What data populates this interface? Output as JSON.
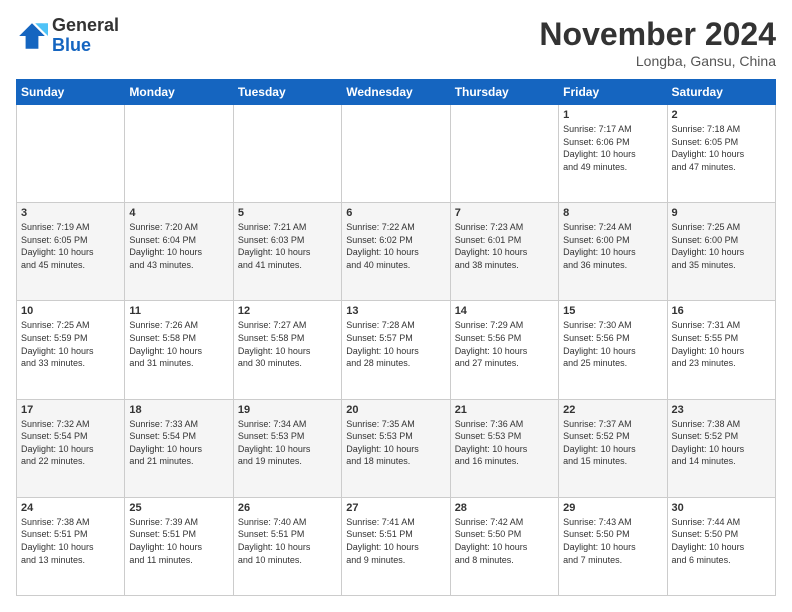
{
  "header": {
    "logo_general": "General",
    "logo_blue": "Blue",
    "month_title": "November 2024",
    "location": "Longba, Gansu, China"
  },
  "calendar": {
    "days_of_week": [
      "Sunday",
      "Monday",
      "Tuesday",
      "Wednesday",
      "Thursday",
      "Friday",
      "Saturday"
    ],
    "weeks": [
      [
        {
          "day": "",
          "info": ""
        },
        {
          "day": "",
          "info": ""
        },
        {
          "day": "",
          "info": ""
        },
        {
          "day": "",
          "info": ""
        },
        {
          "day": "",
          "info": ""
        },
        {
          "day": "1",
          "info": "Sunrise: 7:17 AM\nSunset: 6:06 PM\nDaylight: 10 hours\nand 49 minutes."
        },
        {
          "day": "2",
          "info": "Sunrise: 7:18 AM\nSunset: 6:05 PM\nDaylight: 10 hours\nand 47 minutes."
        }
      ],
      [
        {
          "day": "3",
          "info": "Sunrise: 7:19 AM\nSunset: 6:05 PM\nDaylight: 10 hours\nand 45 minutes."
        },
        {
          "day": "4",
          "info": "Sunrise: 7:20 AM\nSunset: 6:04 PM\nDaylight: 10 hours\nand 43 minutes."
        },
        {
          "day": "5",
          "info": "Sunrise: 7:21 AM\nSunset: 6:03 PM\nDaylight: 10 hours\nand 41 minutes."
        },
        {
          "day": "6",
          "info": "Sunrise: 7:22 AM\nSunset: 6:02 PM\nDaylight: 10 hours\nand 40 minutes."
        },
        {
          "day": "7",
          "info": "Sunrise: 7:23 AM\nSunset: 6:01 PM\nDaylight: 10 hours\nand 38 minutes."
        },
        {
          "day": "8",
          "info": "Sunrise: 7:24 AM\nSunset: 6:00 PM\nDaylight: 10 hours\nand 36 minutes."
        },
        {
          "day": "9",
          "info": "Sunrise: 7:25 AM\nSunset: 6:00 PM\nDaylight: 10 hours\nand 35 minutes."
        }
      ],
      [
        {
          "day": "10",
          "info": "Sunrise: 7:25 AM\nSunset: 5:59 PM\nDaylight: 10 hours\nand 33 minutes."
        },
        {
          "day": "11",
          "info": "Sunrise: 7:26 AM\nSunset: 5:58 PM\nDaylight: 10 hours\nand 31 minutes."
        },
        {
          "day": "12",
          "info": "Sunrise: 7:27 AM\nSunset: 5:58 PM\nDaylight: 10 hours\nand 30 minutes."
        },
        {
          "day": "13",
          "info": "Sunrise: 7:28 AM\nSunset: 5:57 PM\nDaylight: 10 hours\nand 28 minutes."
        },
        {
          "day": "14",
          "info": "Sunrise: 7:29 AM\nSunset: 5:56 PM\nDaylight: 10 hours\nand 27 minutes."
        },
        {
          "day": "15",
          "info": "Sunrise: 7:30 AM\nSunset: 5:56 PM\nDaylight: 10 hours\nand 25 minutes."
        },
        {
          "day": "16",
          "info": "Sunrise: 7:31 AM\nSunset: 5:55 PM\nDaylight: 10 hours\nand 23 minutes."
        }
      ],
      [
        {
          "day": "17",
          "info": "Sunrise: 7:32 AM\nSunset: 5:54 PM\nDaylight: 10 hours\nand 22 minutes."
        },
        {
          "day": "18",
          "info": "Sunrise: 7:33 AM\nSunset: 5:54 PM\nDaylight: 10 hours\nand 21 minutes."
        },
        {
          "day": "19",
          "info": "Sunrise: 7:34 AM\nSunset: 5:53 PM\nDaylight: 10 hours\nand 19 minutes."
        },
        {
          "day": "20",
          "info": "Sunrise: 7:35 AM\nSunset: 5:53 PM\nDaylight: 10 hours\nand 18 minutes."
        },
        {
          "day": "21",
          "info": "Sunrise: 7:36 AM\nSunset: 5:53 PM\nDaylight: 10 hours\nand 16 minutes."
        },
        {
          "day": "22",
          "info": "Sunrise: 7:37 AM\nSunset: 5:52 PM\nDaylight: 10 hours\nand 15 minutes."
        },
        {
          "day": "23",
          "info": "Sunrise: 7:38 AM\nSunset: 5:52 PM\nDaylight: 10 hours\nand 14 minutes."
        }
      ],
      [
        {
          "day": "24",
          "info": "Sunrise: 7:38 AM\nSunset: 5:51 PM\nDaylight: 10 hours\nand 13 minutes."
        },
        {
          "day": "25",
          "info": "Sunrise: 7:39 AM\nSunset: 5:51 PM\nDaylight: 10 hours\nand 11 minutes."
        },
        {
          "day": "26",
          "info": "Sunrise: 7:40 AM\nSunset: 5:51 PM\nDaylight: 10 hours\nand 10 minutes."
        },
        {
          "day": "27",
          "info": "Sunrise: 7:41 AM\nSunset: 5:51 PM\nDaylight: 10 hours\nand 9 minutes."
        },
        {
          "day": "28",
          "info": "Sunrise: 7:42 AM\nSunset: 5:50 PM\nDaylight: 10 hours\nand 8 minutes."
        },
        {
          "day": "29",
          "info": "Sunrise: 7:43 AM\nSunset: 5:50 PM\nDaylight: 10 hours\nand 7 minutes."
        },
        {
          "day": "30",
          "info": "Sunrise: 7:44 AM\nSunset: 5:50 PM\nDaylight: 10 hours\nand 6 minutes."
        }
      ]
    ]
  }
}
